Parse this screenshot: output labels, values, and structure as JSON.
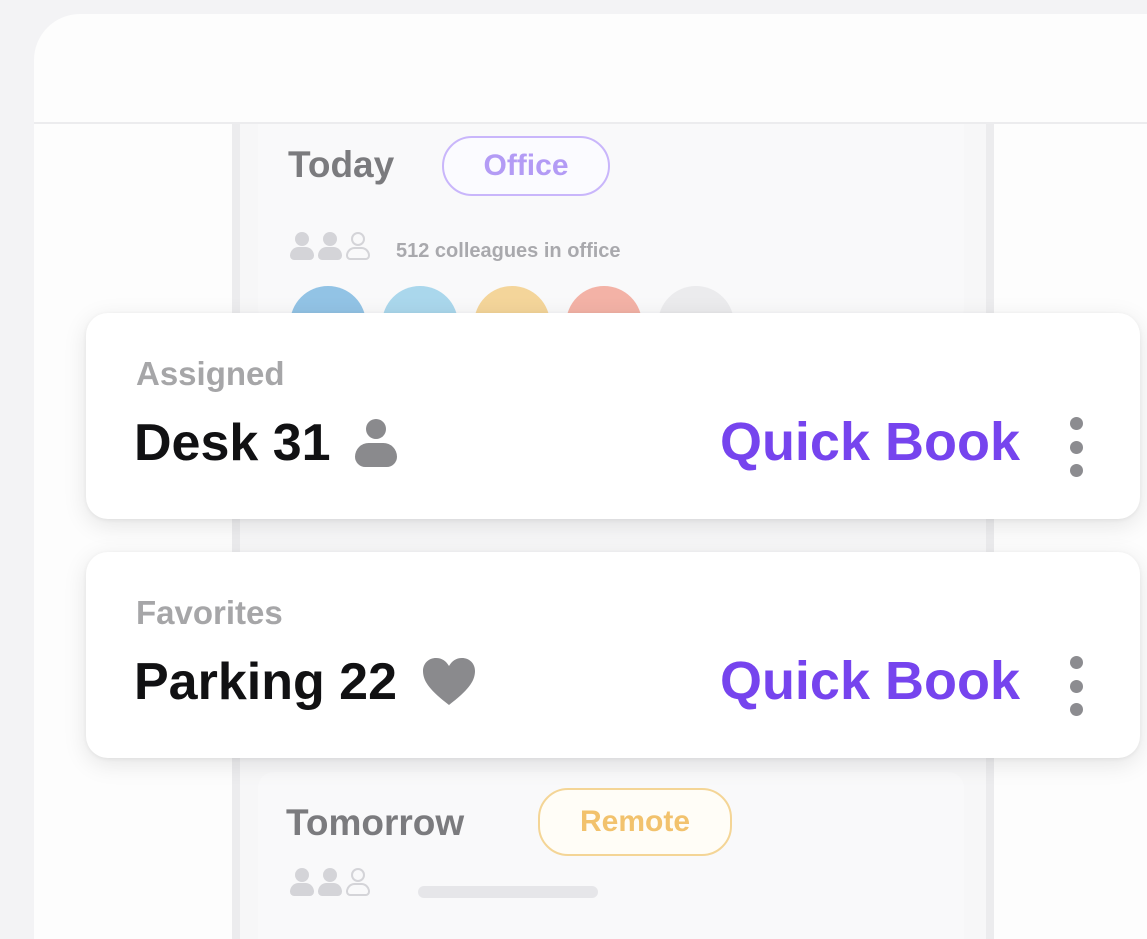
{
  "today": {
    "title": "Today",
    "mode": "Office",
    "colleagues_text": "512 colleagues in office"
  },
  "tomorrow": {
    "title": "Tomorrow",
    "mode": "Remote"
  },
  "cards": {
    "assigned": {
      "label": "Assigned",
      "title": "Desk 31",
      "icon": "person-icon",
      "action": "Quick Book"
    },
    "favorites": {
      "label": "Favorites",
      "title": "Parking 22",
      "icon": "heart-icon",
      "action": "Quick Book"
    }
  },
  "colors": {
    "accent": "#7644ee",
    "office_pill": "#b39bf5",
    "remote_pill": "#f2c26d"
  }
}
